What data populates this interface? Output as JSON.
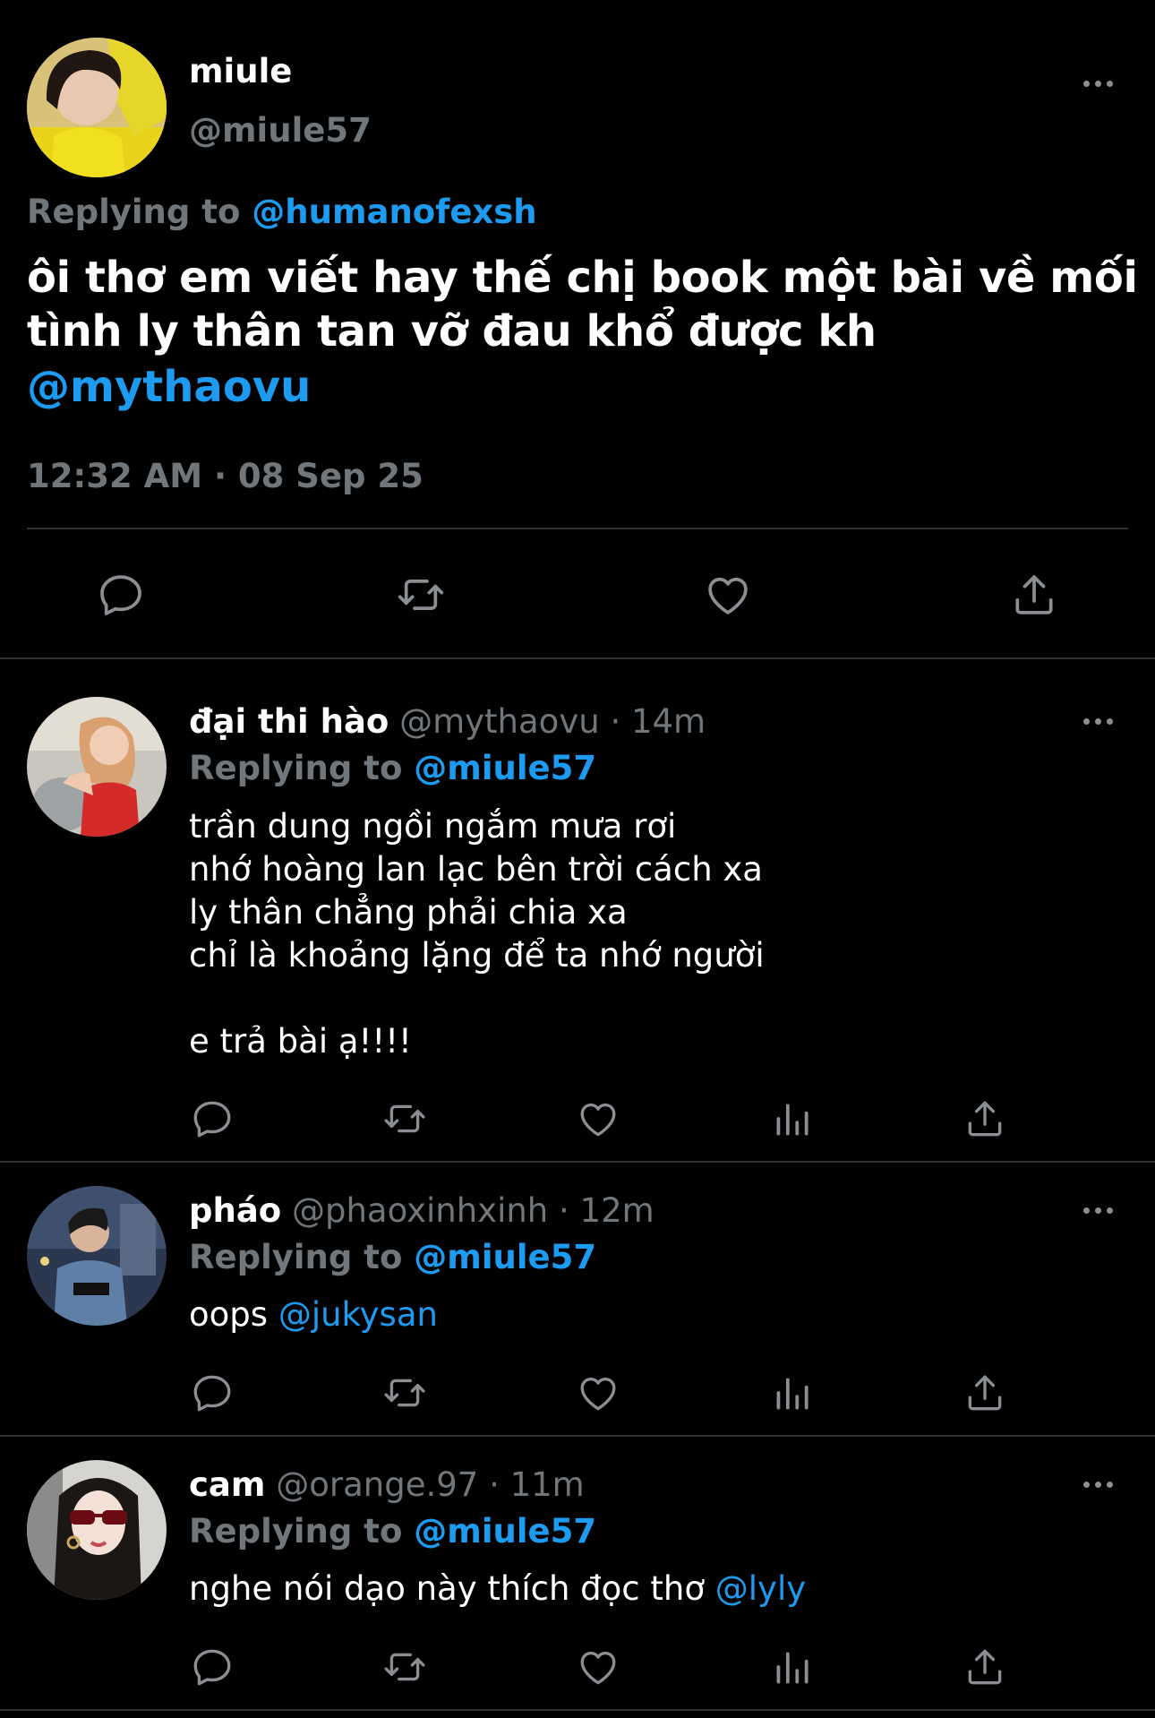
{
  "main_tweet": {
    "display_name": "miule",
    "handle": "@miule57",
    "replying_prefix": "Replying to",
    "replying_handle": "@humanofexsh",
    "text_line1": "ôi thơ em viết hay thế chị book một bài về mối",
    "text_line2": "tình ly thân tan vỡ đau khổ được kh",
    "mention": "@mythaovu",
    "timestamp": "12:32 AM · 08 Sep 25"
  },
  "replies": [
    {
      "display_name": "đại thi hào",
      "handle": "@mythaovu",
      "time": "· 14m",
      "replying_prefix": "Replying to",
      "replying_handle": "@miule57",
      "lines": [
        "trần dung ngồi ngắm mưa rơi",
        "nhớ hoàng lan lạc bên trời cách xa",
        "ly thân chẳng phải chia xa",
        "chỉ là khoảng lặng để ta nhớ người",
        "",
        "e trả bài ạ!!!!"
      ]
    },
    {
      "display_name": "pháo",
      "handle": "@phaoxinhxinh",
      "time": "· 12m",
      "replying_prefix": "Replying to",
      "replying_handle": "@miule57",
      "text": "oops",
      "mention": "@jukysan"
    },
    {
      "display_name": "cam",
      "handle": "@orange.97",
      "time": "· 11m",
      "replying_prefix": "Replying to",
      "replying_handle": "@miule57",
      "text": "nghe nói dạo này thích đọc thơ",
      "mention": "@lyly"
    }
  ],
  "colors": {
    "background": "#000000",
    "text": "#ffffff",
    "secondary": "#71767b",
    "link": "#1d9bf0",
    "divider": "#2f3336"
  }
}
